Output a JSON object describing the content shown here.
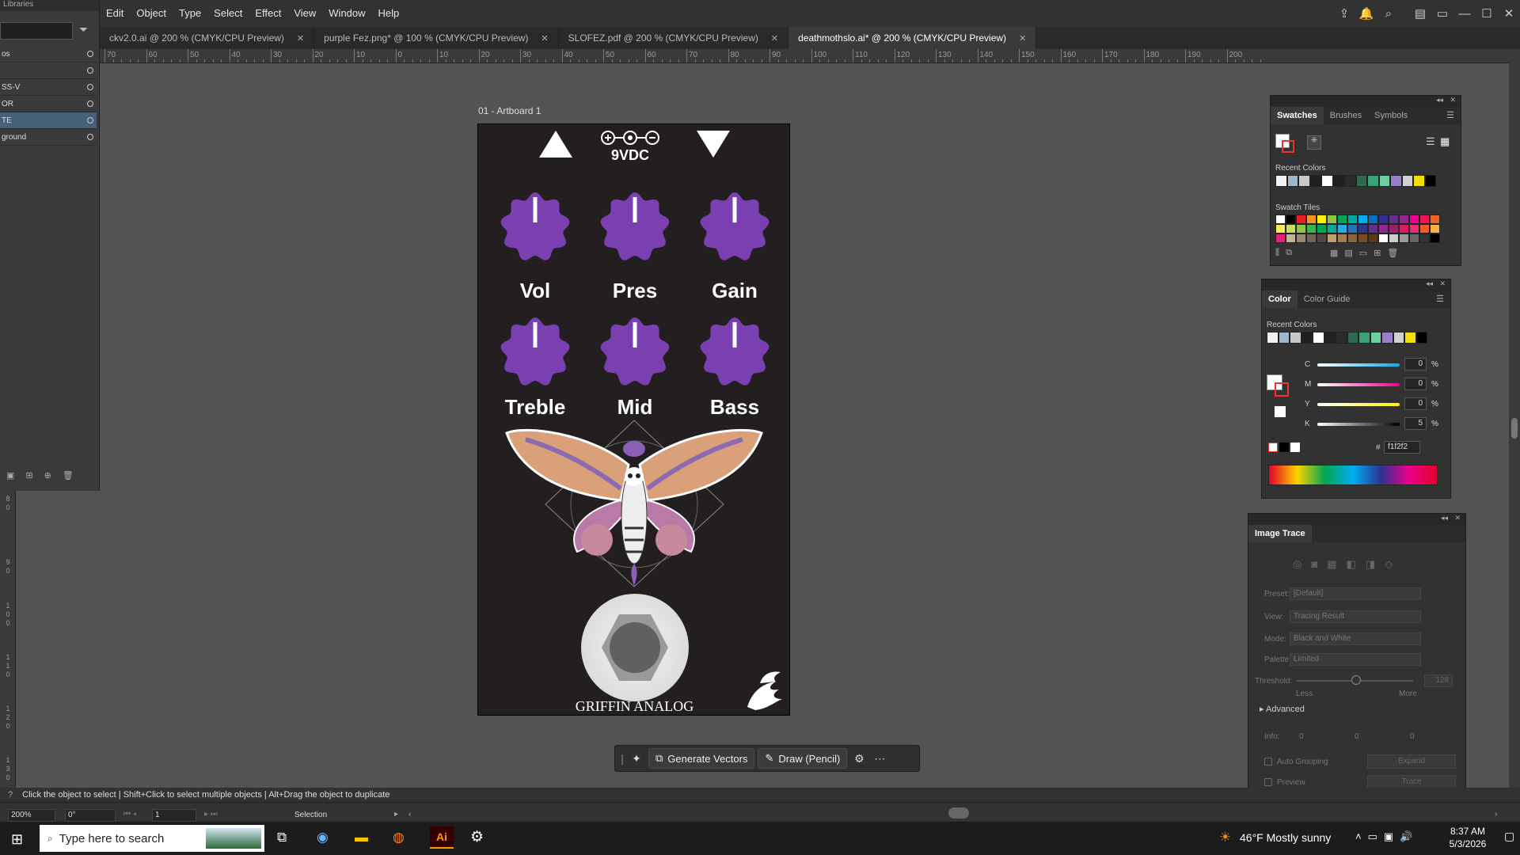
{
  "menu": {
    "items": [
      "Edit",
      "Object",
      "Type",
      "Select",
      "Effect",
      "View",
      "Window",
      "Help"
    ]
  },
  "left_panel": {
    "title": "Libraries",
    "layers": [
      {
        "name": "os"
      },
      {
        "name": ""
      },
      {
        "name": "SS-V"
      },
      {
        "name": "OR"
      },
      {
        "name": "TE"
      },
      {
        "name": "ground"
      }
    ]
  },
  "tabs": [
    {
      "label": "ckv2.0.ai @ 200 % (CMYK/CPU Preview)"
    },
    {
      "label": "purple Fez.png* @ 100 % (CMYK/CPU Preview)"
    },
    {
      "label": "SLOFEZ.pdf @ 200 % (CMYK/CPU Preview)"
    },
    {
      "label": "deathmothslo.ai* @ 200 % (CMYK/CPU Preview)"
    }
  ],
  "ruler_top": [
    "70",
    "60",
    "50",
    "40",
    "30",
    "20",
    "10",
    "0",
    "10",
    "20",
    "30",
    "40",
    "50",
    "60",
    "70",
    "80",
    "90",
    "100",
    "110",
    "120",
    "130",
    "140",
    "150",
    "160",
    "170",
    "180",
    "190",
    "200"
  ],
  "artboard": {
    "label": "01 - Artboard 1",
    "power_label": "9VDC",
    "knobs": [
      {
        "label": "Vol"
      },
      {
        "label": "Pres"
      },
      {
        "label": "Gain"
      },
      {
        "label": "Treble"
      },
      {
        "label": "Mid"
      },
      {
        "label": "Bass"
      }
    ],
    "brand": "GRIFFIN ANALOG",
    "knob_color": "#7a3fb0"
  },
  "context_bar": {
    "generate": "Generate Vectors",
    "draw": "Draw (Pencil)"
  },
  "swatches_panel": {
    "tabs": [
      "Swatches",
      "Brushes",
      "Symbols"
    ],
    "recent_label": "Recent Colors",
    "tiles_label": "Swatch Tiles"
  },
  "color_panel": {
    "tabs": [
      "Color",
      "Color Guide"
    ],
    "recent_label": "Recent Colors",
    "channels": [
      {
        "name": "C",
        "value": "0"
      },
      {
        "name": "M",
        "value": "0"
      },
      {
        "name": "Y",
        "value": "0"
      },
      {
        "name": "K",
        "value": "5"
      }
    ],
    "percent": "%",
    "hex": "f1f2f2"
  },
  "image_trace": {
    "title": "Image Trace",
    "preset_label": "Preset:",
    "preset_value": "[Default]",
    "view_label": "View:",
    "view_value": "Tracing Result",
    "mode_label": "Mode:",
    "mode_value": "Black and White",
    "palette_label": "Palette:",
    "palette_value": "Limited",
    "threshold_label": "Threshold:",
    "threshold_value": "128",
    "less": "Less",
    "more": "More",
    "advanced": "Advanced",
    "info_label": "Info:",
    "info_values": [
      "0",
      "0",
      "0"
    ],
    "auto_grouping": "Auto Grouping",
    "expand": "Expand",
    "preview": "Preview",
    "trace": "Trace"
  },
  "status": {
    "hint": "Click the object to select  |  Shift+Click to select multiple objects  |  Alt+Drag the object to duplicate",
    "zoom": "200%",
    "rotate": "0°",
    "artboard_num": "1",
    "tool": "Selection"
  },
  "taskbar": {
    "search_placeholder": "Type here to search",
    "weather": "46°F  Mostly sunny",
    "time": "8:37 AM",
    "date": "5/3/2026"
  }
}
